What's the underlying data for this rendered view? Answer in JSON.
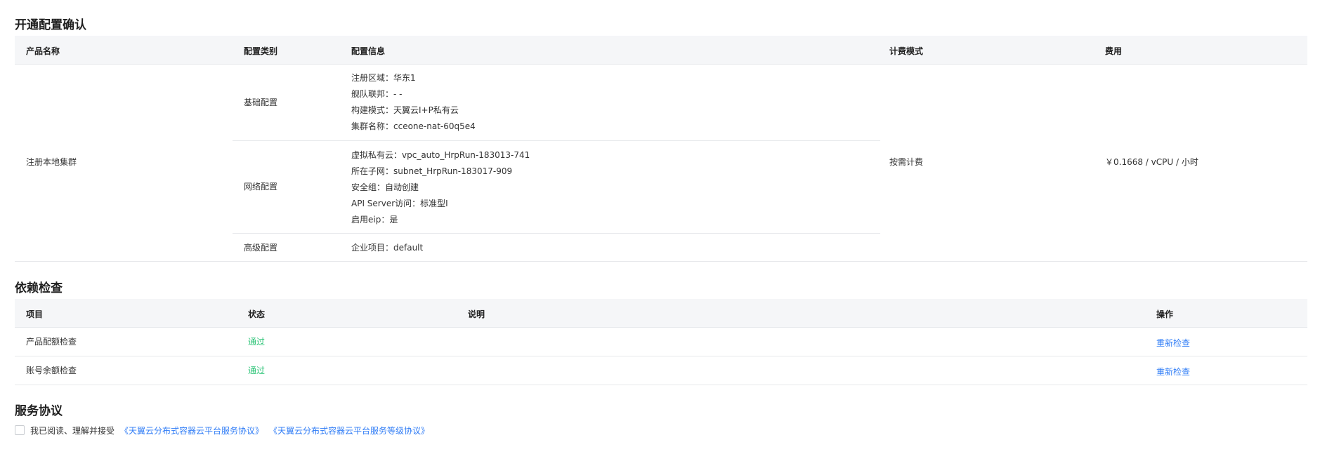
{
  "config_confirm": {
    "title": "开通配置确认",
    "headers": {
      "product": "产品名称",
      "category": "配置类别",
      "info": "配置信息",
      "billing": "计费模式",
      "fee": "费用"
    },
    "product_name": "注册本地集群",
    "billing_mode": "按需计费",
    "fee": "￥0.1668 / vCPU / 小时",
    "groups": [
      {
        "category": "基础配置",
        "items": [
          "注册区域：华东1",
          "舰队联邦：- -",
          "构建模式：天翼云I+P私有云",
          "集群名称：cceone-nat-60q5e4"
        ]
      },
      {
        "category": "网络配置",
        "items": [
          "虚拟私有云：vpc_auto_HrpRun-183013-741",
          "所在子网：subnet_HrpRun-183017-909",
          "安全组：自动创建",
          "API Server访问：标准型I",
          "启用eip：是"
        ]
      },
      {
        "category": "高级配置",
        "items": [
          "企业项目：default"
        ]
      }
    ]
  },
  "dependency_check": {
    "title": "依赖检查",
    "headers": {
      "item": "项目",
      "status": "状态",
      "desc": "说明",
      "action": "操作"
    },
    "rows": [
      {
        "item": "产品配额检查",
        "status": "通过",
        "desc": "",
        "action": "重新检查"
      },
      {
        "item": "账号余额检查",
        "status": "通过",
        "desc": "",
        "action": "重新检查"
      }
    ]
  },
  "service_agreement": {
    "title": "服务协议",
    "checkbox_label": "我已阅读、理解并接受",
    "link1": "《天翼云分布式容器云平台服务协议》",
    "link2": "《天翼云分布式容器云平台服务等级协议》"
  },
  "colors": {
    "pass": "#2bc376",
    "link": "#2f7cf6",
    "header_bg": "#f5f6f8",
    "border": "#e6e8eb"
  }
}
